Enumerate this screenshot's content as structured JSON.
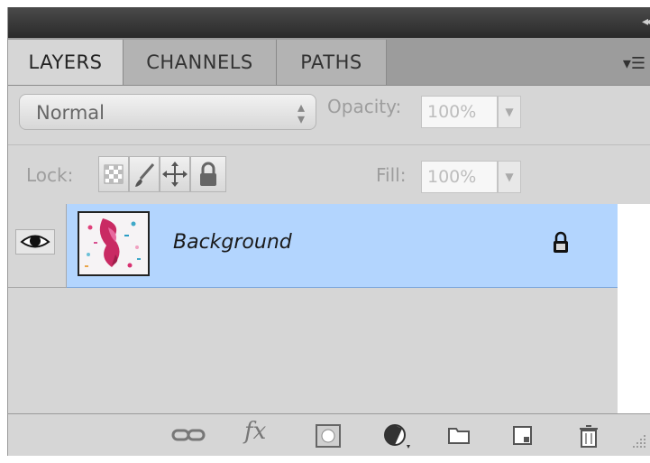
{
  "tabs": [
    {
      "label": "LAYERS",
      "active": true
    },
    {
      "label": "CHANNELS",
      "active": false
    },
    {
      "label": "PATHS",
      "active": false
    }
  ],
  "blend_mode": {
    "value": "Normal"
  },
  "opacity": {
    "label": "Opacity:",
    "value": "100%"
  },
  "lock": {
    "label": "Lock:"
  },
  "fill": {
    "label": "Fill:",
    "value": "100%"
  },
  "layers": [
    {
      "name": "Background",
      "visible": true,
      "locked": true,
      "selected": true
    }
  ],
  "colors": {
    "selection": "#b3d5fe",
    "panel": "#d6d6d6",
    "titlebar": "#333333"
  },
  "icons": {
    "panel_menu": "panel-menu-icon",
    "collapse": "collapse-arrows-icon",
    "visibility": "eye-icon",
    "bottom": [
      "link-layers-icon",
      "fx-icon",
      "layer-mask-icon",
      "adjustment-layer-icon",
      "new-group-icon",
      "new-layer-icon",
      "trash-icon"
    ]
  },
  "bottom": {
    "fx_glyph": "fx"
  }
}
